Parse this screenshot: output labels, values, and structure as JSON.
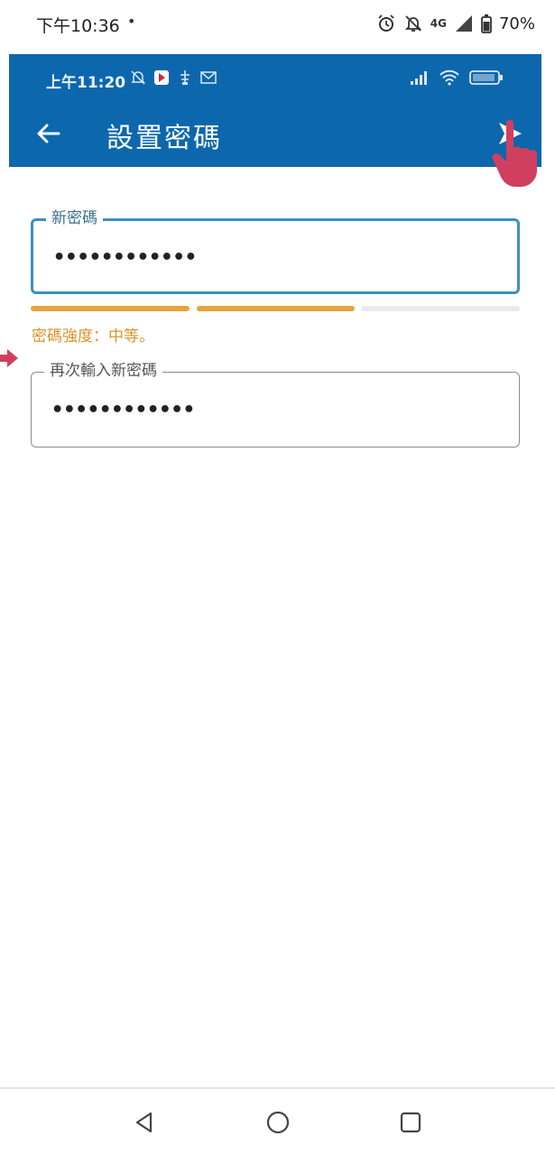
{
  "device_status": {
    "time": "下午10:36",
    "dot": "•",
    "network": "4G",
    "battery": "70%",
    "icons": [
      "alarm-icon",
      "mute-icon",
      "network-4g-icon",
      "signal-icon",
      "battery-icon"
    ]
  },
  "app_status": {
    "time": "上午11:20",
    "left_icons": [
      "mute-icon",
      "app-notification-icon",
      "usb-icon",
      "mail-icon"
    ],
    "right_icons": [
      "signal-icon",
      "wifi-icon",
      "battery-icon"
    ]
  },
  "toolbar": {
    "title": "設置密碼",
    "back_icon": "arrow-left-icon",
    "send_icon": "send-icon"
  },
  "form": {
    "new_password": {
      "label": "新密碼",
      "value": "••••••••••••"
    },
    "strength": {
      "text": "密碼強度：中等。",
      "level": 0.6667,
      "color": "#e6a33e"
    },
    "confirm_password": {
      "label": "再次輸入新密碼",
      "value": "••••••••••••"
    }
  },
  "nav": {
    "icons": [
      "back-triangle-icon",
      "home-circle-icon",
      "recents-square-icon"
    ]
  },
  "colors": {
    "app_bar": "#0d67ad",
    "focus_border": "#3f8fbc",
    "strength": "#e6a33e",
    "annotation": "#d0405e"
  }
}
